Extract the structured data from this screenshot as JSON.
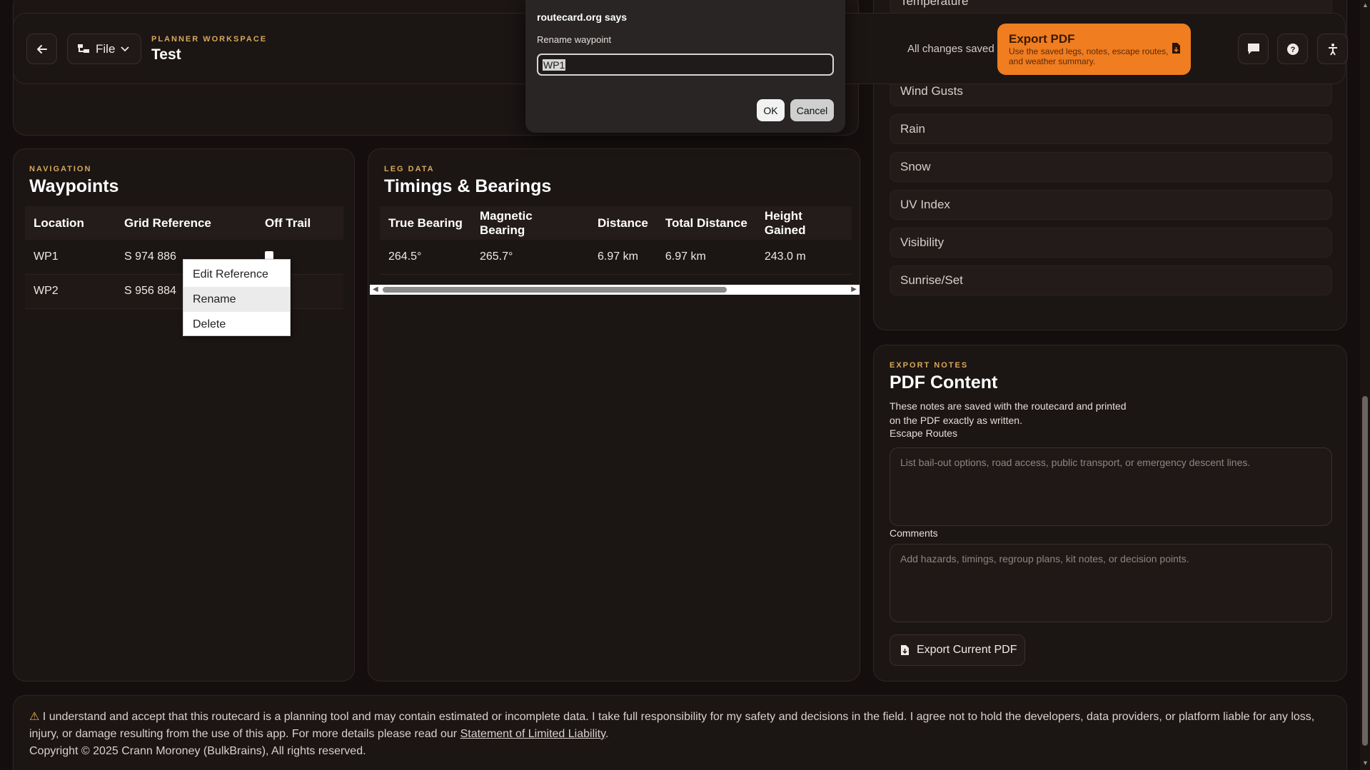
{
  "header": {
    "eyebrow": "PLANNER WORKSPACE",
    "title": "Test",
    "file_label": "File",
    "saved_status": "All changes saved",
    "export_pdf": {
      "title": "Export PDF",
      "subtitle": "Use the saved legs, notes, escape routes, and weather summary."
    }
  },
  "weather": {
    "items": [
      "Temperature",
      "Wind Gusts",
      "Rain",
      "Snow",
      "UV Index",
      "Visibility",
      "Sunrise/Set"
    ]
  },
  "waypoints": {
    "eyebrow": "NAVIGATION",
    "title": "Waypoints",
    "columns": [
      "Location",
      "Grid Reference",
      "Off Trail"
    ],
    "rows": [
      {
        "location": "WP1",
        "grid": "S 974 886"
      },
      {
        "location": "WP2",
        "grid": "S 956 884"
      }
    ]
  },
  "context_menu": {
    "items": [
      "Edit Reference",
      "Rename",
      "Delete"
    ]
  },
  "timings": {
    "eyebrow": "LEG DATA",
    "title": "Timings & Bearings",
    "columns": [
      "True Bearing",
      "Magnetic Bearing",
      "Distance",
      "Total Distance",
      "Height Gained"
    ],
    "rows": [
      {
        "true_bearing": "264.5°",
        "magnetic_bearing": "265.7°",
        "distance": "6.97 km",
        "total_distance": "6.97 km",
        "height_gained": "243.0 m"
      }
    ]
  },
  "notes": {
    "eyebrow": "EXPORT NOTES",
    "title": "PDF Content",
    "description_line1": "These notes are saved with the routecard and printed",
    "description_line2": "on the PDF exactly as written.",
    "escape_label": "Escape Routes",
    "escape_placeholder": "List bail-out options, road access, public transport, or emergency descent lines.",
    "comments_label": "Comments",
    "comments_placeholder": "Add hazards, timings, regroup plans, kit notes, or decision points.",
    "export_button": "Export Current PDF"
  },
  "footer": {
    "disclaimer": "I understand and accept that this routecard is a planning tool and may contain estimated or incomplete data. I take full responsibility for my safety and decisions in the field. I agree not to hold the developers, data providers, or platform liable for any loss, injury, or damage resulting from the use of this app. For more details please read our",
    "link": "Statement of Limited Liability",
    "copyright": "Copyright © 2025 Crann Moroney (BulkBrains), All rights reserved."
  },
  "dialog": {
    "title": "routecard.org says",
    "message": "Rename waypoint",
    "input_value": "WP1",
    "ok": "OK",
    "cancel": "Cancel"
  },
  "colors": {
    "accent": "#f07d1f",
    "eyebrow": "#d8a85a",
    "background": "#140f0e",
    "panel": "#1b1514"
  },
  "icons": {
    "back": "arrow-left-icon",
    "file": "file-tree-icon",
    "chevron": "chevron-down-icon",
    "export": "file-download-icon",
    "chat": "chat-bubble-icon",
    "help": "help-circle-icon",
    "accessibility": "accessibility-icon",
    "warning": "warning-icon"
  }
}
